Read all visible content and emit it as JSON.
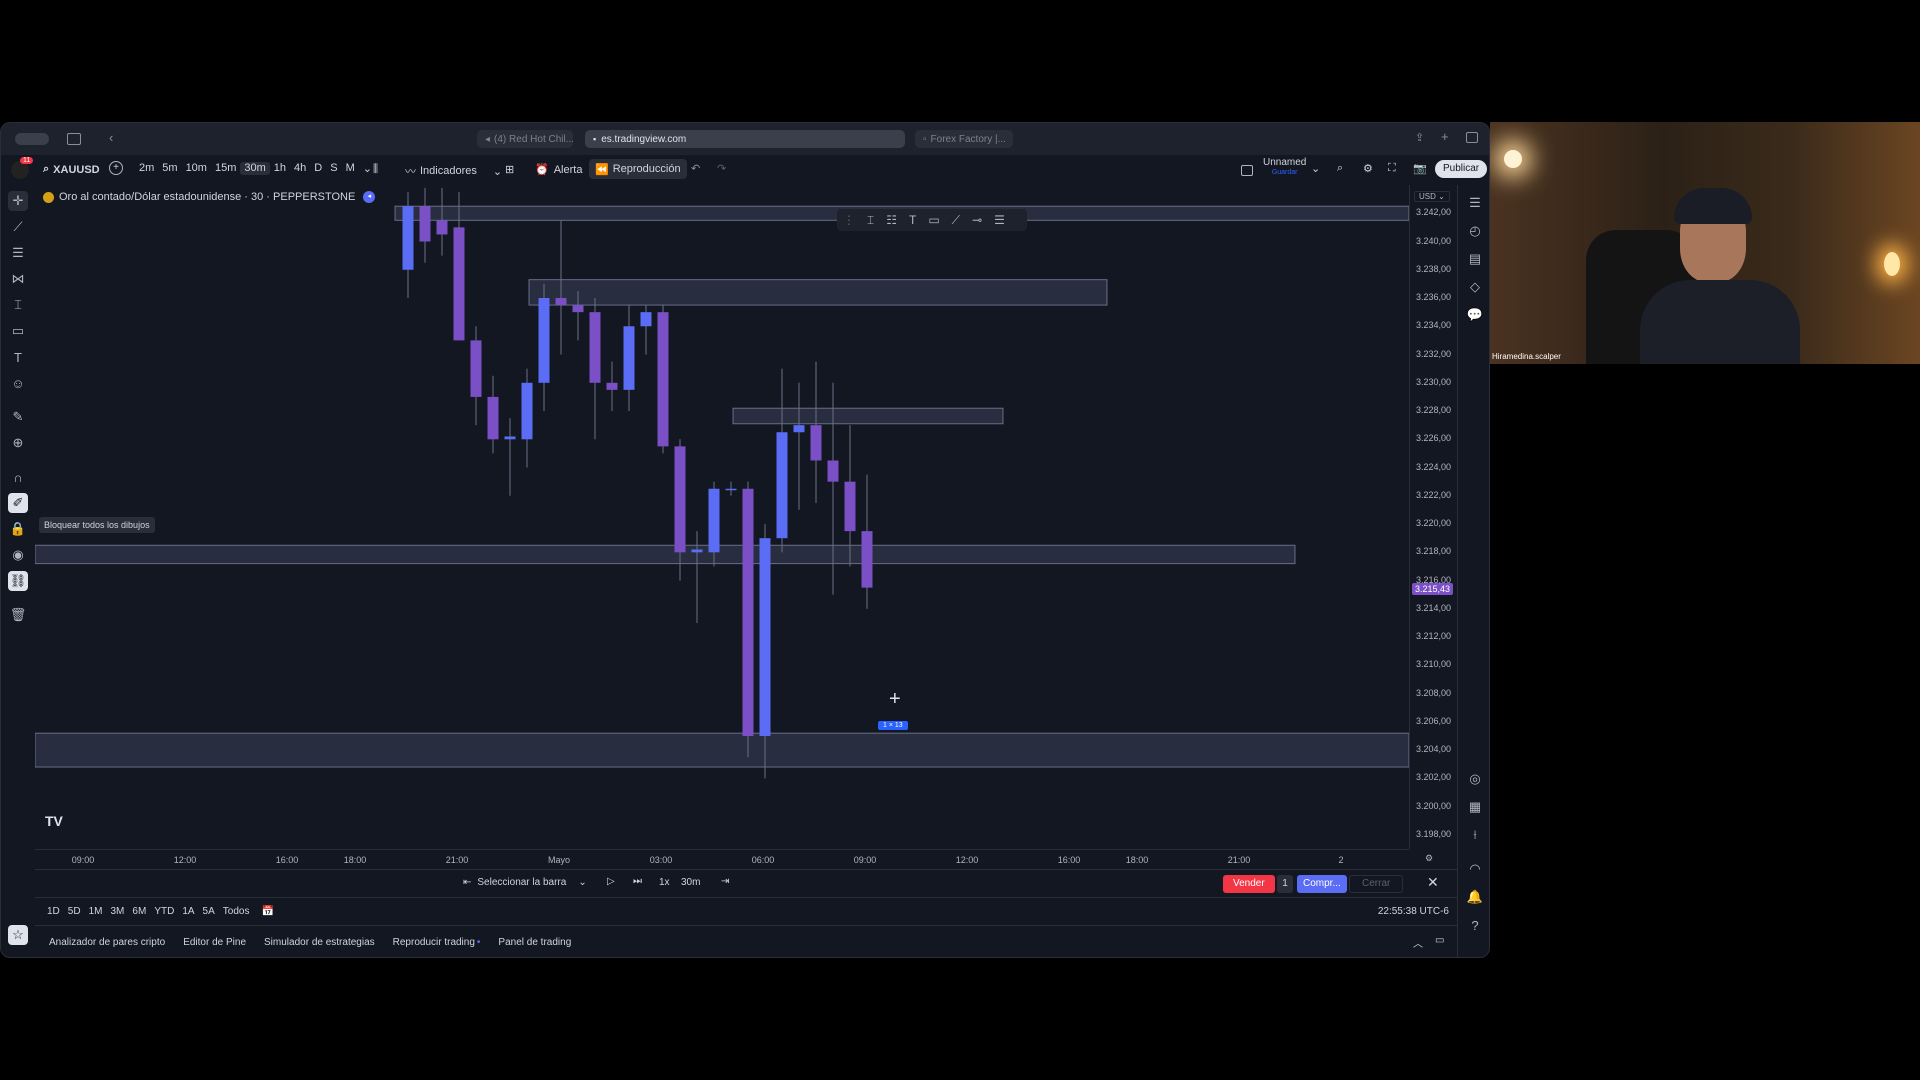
{
  "browser": {
    "tabs": [
      {
        "label": "(4) Red Hot Chil..."
      },
      {
        "label": "es.tradingview.com"
      },
      {
        "label": "Forex Factory |..."
      }
    ]
  },
  "toolbar": {
    "notif_count": "11",
    "symbol": "XAUUSD",
    "intervals": [
      "2m",
      "5m",
      "10m",
      "15m",
      "30m",
      "1h",
      "4h",
      "D",
      "S",
      "M"
    ],
    "active_interval": "30m",
    "indicators_label": "Indicadores",
    "alert_label": "Alerta",
    "replay_label": "Reproducción",
    "layout_name": "Unnamed",
    "layout_sub": "Guardar",
    "publish_label": "Publicar"
  },
  "chart": {
    "title": "Oro al contado/Dólar estadounidense · 30 · PEPPERSTONE",
    "currency": "USD",
    "tooltip": "Bloquear todos los dibujos",
    "current_price": "3.215,43",
    "cursor_badge": "1 × 13",
    "y_ticks": [
      "3.242,00",
      "3.240,00",
      "3.238,00",
      "3.236,00",
      "3.234,00",
      "3.232,00",
      "3.230,00",
      "3.228,00",
      "3.226,00",
      "3.224,00",
      "3.222,00",
      "3.220,00",
      "3.218,00",
      "3.216,00",
      "3.214,00",
      "3.212,00",
      "3.210,00",
      "3.208,00",
      "3.206,00",
      "3.204,00",
      "3.202,00",
      "3.200,00",
      "3.198,00"
    ],
    "x_ticks": [
      "09:00",
      "12:00",
      "16:00",
      "18:00",
      "21:00",
      "Mayo",
      "03:00",
      "06:00",
      "09:00",
      "12:00",
      "16:00",
      "18:00",
      "21:00",
      "2"
    ]
  },
  "chart_data": {
    "type": "candlestick",
    "title": "Oro al contado/Dólar estadounidense · 30 · PEPPERSTONE",
    "ylim": [
      3197,
      3244
    ],
    "candles": [
      {
        "o": 3238.0,
        "h": 3243.5,
        "l": 3236.0,
        "c": 3242.5
      },
      {
        "o": 3242.5,
        "h": 3243.8,
        "l": 3238.5,
        "c": 3240.0
      },
      {
        "o": 3241.5,
        "h": 3243.8,
        "l": 3239.0,
        "c": 3240.5
      },
      {
        "o": 3241.0,
        "h": 3243.5,
        "l": 3233.5,
        "c": 3233.0
      },
      {
        "o": 3233.0,
        "h": 3234.0,
        "l": 3227.0,
        "c": 3229.0
      },
      {
        "o": 3229.0,
        "h": 3230.5,
        "l": 3225.0,
        "c": 3226.0
      },
      {
        "o": 3226.0,
        "h": 3227.5,
        "l": 3222.0,
        "c": 3226.2
      },
      {
        "o": 3226.0,
        "h": 3231.0,
        "l": 3224.0,
        "c": 3230.0
      },
      {
        "o": 3230.0,
        "h": 3237.0,
        "l": 3228.0,
        "c": 3236.0
      },
      {
        "o": 3236.0,
        "h": 3241.5,
        "l": 3232.0,
        "c": 3235.5
      },
      {
        "o": 3235.5,
        "h": 3236.5,
        "l": 3233.0,
        "c": 3235.0
      },
      {
        "o": 3235.0,
        "h": 3236.0,
        "l": 3226.0,
        "c": 3230.0
      },
      {
        "o": 3230.0,
        "h": 3231.5,
        "l": 3228.0,
        "c": 3229.5
      },
      {
        "o": 3229.5,
        "h": 3235.5,
        "l": 3228.0,
        "c": 3234.0
      },
      {
        "o": 3234.0,
        "h": 3235.5,
        "l": 3232.0,
        "c": 3235.0
      },
      {
        "o": 3235.0,
        "h": 3235.5,
        "l": 3225.0,
        "c": 3225.5
      },
      {
        "o": 3225.5,
        "h": 3226.0,
        "l": 3216.0,
        "c": 3218.0
      },
      {
        "o": 3218.0,
        "h": 3219.5,
        "l": 3213.0,
        "c": 3218.2
      },
      {
        "o": 3218.0,
        "h": 3223.0,
        "l": 3217.0,
        "c": 3222.5
      },
      {
        "o": 3222.5,
        "h": 3223.0,
        "l": 3222.0,
        "c": 3222.5
      },
      {
        "o": 3222.5,
        "h": 3223.0,
        "l": 3203.5,
        "c": 3205.0
      },
      {
        "o": 3205.0,
        "h": 3220.0,
        "l": 3202.0,
        "c": 3219.0
      },
      {
        "o": 3219.0,
        "h": 3231.0,
        "l": 3218.0,
        "c": 3226.5
      },
      {
        "o": 3226.5,
        "h": 3230.0,
        "l": 3221.0,
        "c": 3227.0
      },
      {
        "o": 3227.0,
        "h": 3231.5,
        "l": 3221.5,
        "c": 3224.5
      },
      {
        "o": 3224.5,
        "h": 3230.0,
        "l": 3215.0,
        "c": 3223.0
      },
      {
        "o": 3223.0,
        "h": 3227.0,
        "l": 3217.0,
        "c": 3219.5
      },
      {
        "o": 3219.5,
        "h": 3223.5,
        "l": 3214.0,
        "c": 3215.5
      }
    ],
    "zones": [
      {
        "top": 3242.5,
        "bottom": 3241.5
      },
      {
        "top": 3237.3,
        "bottom": 3235.5
      },
      {
        "top": 3228.2,
        "bottom": 3227.1
      },
      {
        "top": 3218.5,
        "bottom": 3217.2
      },
      {
        "top": 3205.2,
        "bottom": 3202.8
      }
    ],
    "last_price": 3215.43
  },
  "replay": {
    "select_bar": "Seleccionar la barra",
    "speed": "1x",
    "interval": "30m",
    "sell": "Vender",
    "qty": "1",
    "buy": "Compr...",
    "close": "Cerrar"
  },
  "ranges": {
    "items": [
      "1D",
      "5D",
      "1M",
      "3M",
      "6M",
      "YTD",
      "1A",
      "5A",
      "Todos"
    ],
    "clock": "22:55:38 UTC-6"
  },
  "bottom_tabs": [
    "Analizador de pares cripto",
    "Editor de Pine",
    "Simulador de estrategias",
    "Reproducir trading",
    "Panel de trading"
  ],
  "webcam": {
    "username": "Hiramedina.scalper"
  },
  "colors": {
    "bull": "#5b6cf5",
    "bear": "#7b4fc6",
    "background": "#131722",
    "sell": "#f23645",
    "buy": "#5b6cf5"
  }
}
